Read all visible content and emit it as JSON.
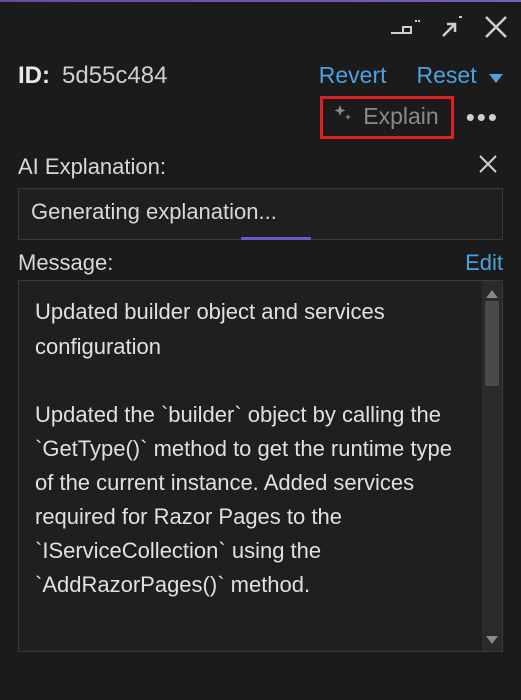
{
  "toolbar": {
    "revert_label": "Revert",
    "reset_label": "Reset"
  },
  "id": {
    "label": "ID:",
    "value": "5d55c484"
  },
  "explain": {
    "label": "Explain"
  },
  "ai_explanation": {
    "title": "AI Explanation:",
    "status": "Generating explanation..."
  },
  "message": {
    "title": "Message:",
    "edit_label": "Edit",
    "body": "Updated builder object and services configuration\n\nUpdated the `builder` object by calling the `GetType()` method to get the runtime type of the current instance. Added services required for Razor Pages to the `IServiceCollection` using the `AddRazorPages()` method."
  }
}
